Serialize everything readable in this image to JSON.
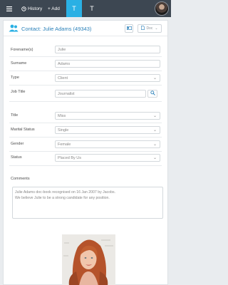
{
  "topbar": {
    "history_label": "History",
    "add_label": "+ Add",
    "tab1_label": "T",
    "tab2_label": "T"
  },
  "header": {
    "title": "Contact: Julie Adams (49343)",
    "doc_label": "Doc"
  },
  "form": {
    "forename_label": "Forename(s)",
    "forename_value": "Julie",
    "surname_label": "Surname",
    "surname_value": "Adams",
    "type_label": "Type",
    "type_value": "Client",
    "jobtitle_label": "Job Title",
    "jobtitle_value": "Journalist",
    "title_label": "Title",
    "title_value": "Miss",
    "marital_label": "Marital Status",
    "marital_value": "Single",
    "gender_label": "Gender",
    "gender_value": "Female",
    "status_label": "Status",
    "status_value": "Placed By Us",
    "comments_label": "Comments",
    "comments_line1": "Julie Adams doc-book recognised on 16 Jan 2007 by Jacobs.",
    "comments_line2": "We believe Julie to be a strong candidate for any position."
  },
  "colors": {
    "topbar": "#3d4752",
    "accent": "#2ab0e4",
    "title_blue": "#2a80b9"
  }
}
